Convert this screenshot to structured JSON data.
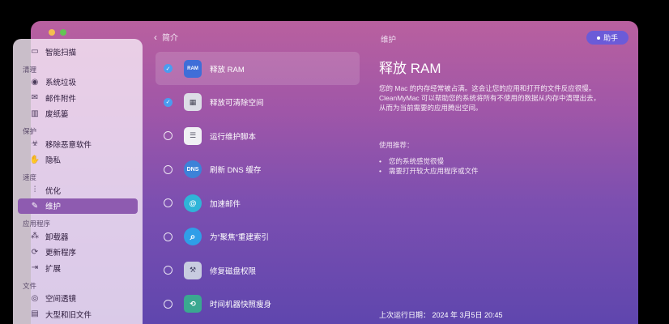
{
  "nav": {
    "back_label": "简介",
    "title": "维护",
    "help_label": "助手"
  },
  "sidebar": [
    {
      "type": "item",
      "label": "智能扫描",
      "icon": "monitor-icon",
      "glyph": "▭"
    },
    {
      "type": "section",
      "label": "清理"
    },
    {
      "type": "item",
      "label": "系统垃圾",
      "icon": "system-junk-icon",
      "glyph": "◉"
    },
    {
      "type": "item",
      "label": "邮件附件",
      "icon": "mail-icon",
      "glyph": "✉"
    },
    {
      "type": "item",
      "label": "废纸篓",
      "icon": "trash-icon",
      "glyph": "▥"
    },
    {
      "type": "section",
      "label": "保护"
    },
    {
      "type": "item",
      "label": "移除恶意软件",
      "icon": "biohazard-icon",
      "glyph": "☣"
    },
    {
      "type": "item",
      "label": "隐私",
      "icon": "hand-icon",
      "glyph": "✋"
    },
    {
      "type": "section",
      "label": "速度"
    },
    {
      "type": "item",
      "label": "优化",
      "icon": "sliders-icon",
      "glyph": "⫶"
    },
    {
      "type": "item",
      "label": "维护",
      "icon": "wrench-icon",
      "glyph": "✎",
      "active": true
    },
    {
      "type": "section",
      "label": "应用程序"
    },
    {
      "type": "item",
      "label": "卸载器",
      "icon": "uninstaller-icon",
      "glyph": "⁂"
    },
    {
      "type": "item",
      "label": "更新程序",
      "icon": "updater-icon",
      "glyph": "⟳"
    },
    {
      "type": "item",
      "label": "扩展",
      "icon": "extensions-icon",
      "glyph": "⇥"
    },
    {
      "type": "section",
      "label": "文件"
    },
    {
      "type": "item",
      "label": "空间透镜",
      "icon": "space-lens-icon",
      "glyph": "◎"
    },
    {
      "type": "item",
      "label": "大型和旧文件",
      "icon": "folder-icon",
      "glyph": "▤"
    }
  ],
  "tasks": [
    {
      "label": "释放 RAM",
      "checked": true,
      "selected": true,
      "icon": "ram-icon",
      "icon_text": "RAM",
      "icon_class": "i-ram"
    },
    {
      "label": "释放可清除空间",
      "checked": true,
      "selected": false,
      "icon": "purgeable-icon",
      "icon_text": "▦",
      "icon_class": "i-purge"
    },
    {
      "label": "运行维护脚本",
      "checked": false,
      "selected": false,
      "icon": "script-icon",
      "icon_text": "☰",
      "icon_class": "i-script"
    },
    {
      "label": "刷新 DNS 缓存",
      "checked": false,
      "selected": false,
      "icon": "dns-icon",
      "icon_text": "DNS",
      "icon_class": "i-dns"
    },
    {
      "label": "加速邮件",
      "checked": false,
      "selected": false,
      "icon": "speed-mail-icon",
      "icon_text": "@",
      "icon_class": "i-mail"
    },
    {
      "label": "为“聚焦”重建索引",
      "checked": false,
      "selected": false,
      "icon": "spotlight-icon",
      "icon_text": "⌕",
      "icon_class": "i-spot"
    },
    {
      "label": "修复磁盘权限",
      "checked": false,
      "selected": false,
      "icon": "disk-permissions-icon",
      "icon_text": "⚒",
      "icon_class": "i-disk"
    },
    {
      "label": "时间机器快照瘦身",
      "checked": false,
      "selected": false,
      "icon": "time-machine-icon",
      "icon_text": "⟲",
      "icon_class": "i-tm"
    }
  ],
  "detail": {
    "title": "释放 RAM",
    "desc_lines": [
      "您的 Mac 的内存经常被占满。这会让您的应用和打开的文件反应很慢。",
      "CleanMyMac 可以帮助您的系统将所有不使用的数据从内存中清理出去，",
      "从而为当前需要的应用腾出空间。"
    ],
    "rec_title": "使用推荐：",
    "rec_items": [
      "您的系统感觉很慢",
      "需要打开较大应用程序或文件"
    ],
    "last_run": "上次运行日期：  2024 年 3月5日 20:45"
  }
}
